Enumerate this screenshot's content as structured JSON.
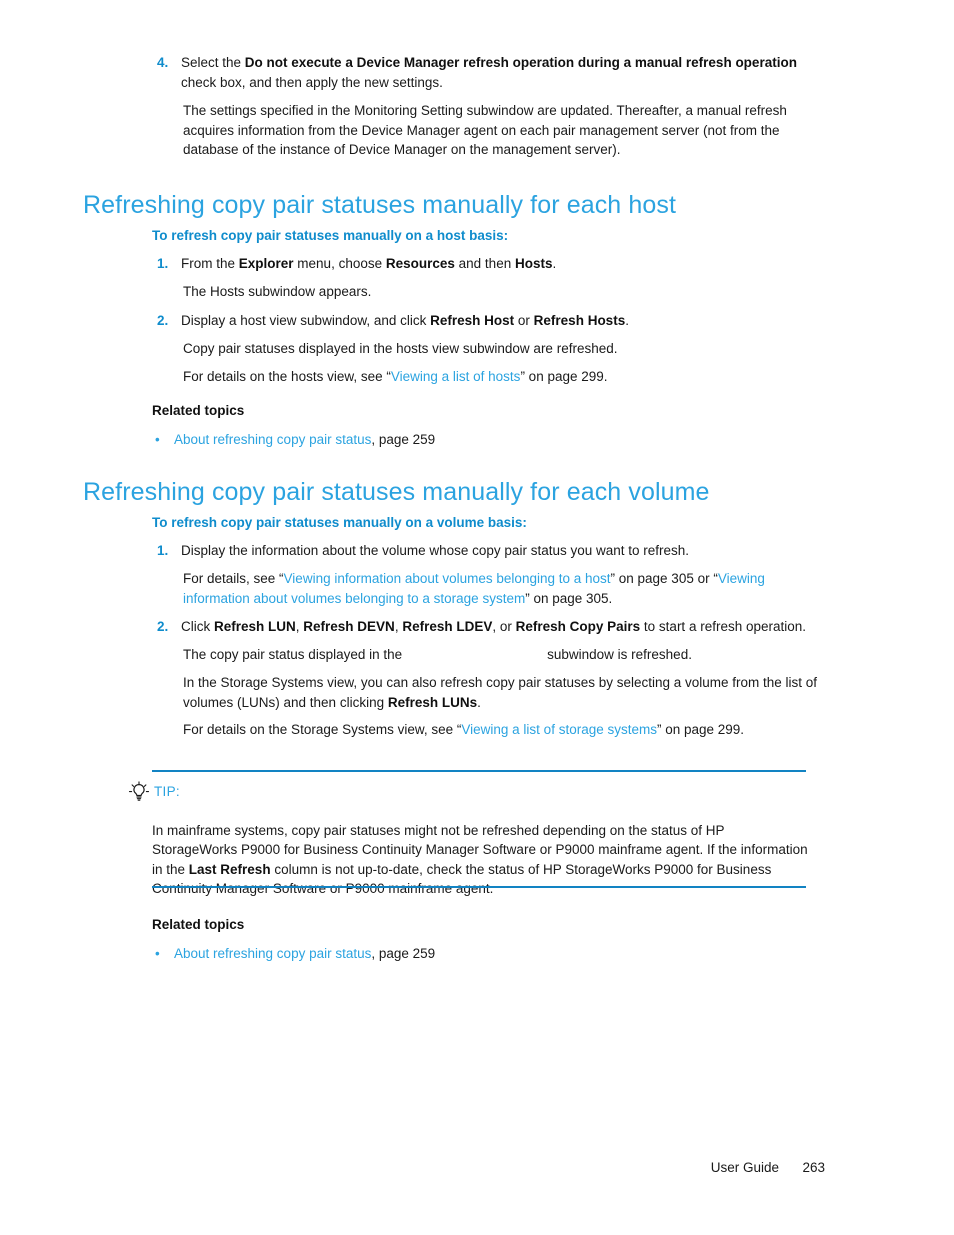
{
  "document": {
    "footer": {
      "guide_label": "User Guide",
      "page_number": "263"
    }
  },
  "step4": {
    "number": "4.",
    "line1_pre": "Select the ",
    "line1_bold": "Do not execute a Device Manager refresh operation during a manual refresh operation",
    "line1_post": " check box, and then apply the new settings.",
    "paragraph": "The settings specified in the Monitoring Setting subwindow are updated. Thereafter, a manual refresh acquires information from the Device Manager agent on each pair management server (not from the database of the instance of Device Manager on the management server)."
  },
  "section_host": {
    "heading": "Refreshing copy pair statuses manually for each host",
    "subheading": "To refresh copy pair statuses manually on a host basis:",
    "step1": {
      "number": "1.",
      "pre": "From the ",
      "bold1": "Explorer",
      "mid1": " menu, choose ",
      "bold2": "Resources",
      "mid2": " and then ",
      "bold3": "Hosts",
      "post": ".",
      "result": "The Hosts subwindow appears."
    },
    "step2": {
      "number": "2.",
      "pre": "Display a host view subwindow, and click ",
      "bold1": "Refresh Host",
      "mid1": " or ",
      "bold2": "Refresh Hosts",
      "post": ".",
      "result": "Copy pair statuses displayed in the hosts view subwindow are refreshed.",
      "details_pre": "For details on the hosts view, see “",
      "details_link": "Viewing a list of hosts",
      "details_post": "” on page 299."
    },
    "related": {
      "title": "Related topics",
      "bullet_marker": "•",
      "link": "About refreshing copy pair status",
      "suffix": ", page 259"
    }
  },
  "section_volume": {
    "heading": "Refreshing copy pair statuses manually for each volume",
    "subheading": "To refresh copy pair statuses manually on a volume basis:",
    "step1": {
      "number": "1.",
      "text": "Display the information about the volume whose copy pair status you want to refresh.",
      "details_pre": "For details, see “",
      "details_link1": "Viewing information about volumes belonging to a host",
      "details_mid": "” on page 305 or “",
      "details_link2": "Viewing information about volumes belonging to a storage system",
      "details_post": "” on page 305."
    },
    "step2": {
      "number": "2.",
      "pre": "Click ",
      "bold1": "Refresh LUN",
      "sep1": ", ",
      "bold2": "Refresh DEVN",
      "sep2": ", ",
      "bold3": "Refresh LDEV",
      "sep3": ", or ",
      "bold4": "Refresh Copy Pairs",
      "post": " to start a refresh operation.",
      "result_pre": "The copy pair status displayed in the",
      "result_post": "subwindow is refreshed.",
      "note_pre": "In the Storage Systems view, you can also refresh copy pair statuses by selecting a volume from the list of volumes (LUNs) and then clicking ",
      "note_bold": "Refresh LUNs",
      "note_post": ".",
      "details_pre": "For details on the Storage Systems view, see “",
      "details_link": "Viewing a list of storage systems",
      "details_post": "” on page 299."
    },
    "related": {
      "title": "Related topics",
      "bullet_marker": "•",
      "link": "About refreshing copy pair status",
      "suffix": ", page 259"
    }
  },
  "tip": {
    "label": "TIP:",
    "text_part1": "In mainframe systems, copy pair statuses might not be refreshed depending on the status of HP StorageWorks P9000 for Business Continuity Manager Software or P9000 mainframe agent. If the information in the ",
    "text_bold": "Last Refresh",
    "text_part2": " column is not up-to-date, check the status of HP StorageWorks P9000 for Business Continuity Manager Software or P9000 mainframe agent."
  },
  "colors": {
    "heading_blue": "#2ba3e0",
    "subheading_blue": "#0f8ccc",
    "link_blue": "#2ba3e0",
    "rule_blue": "#1283c3",
    "body_text": "#1a1a1a"
  }
}
